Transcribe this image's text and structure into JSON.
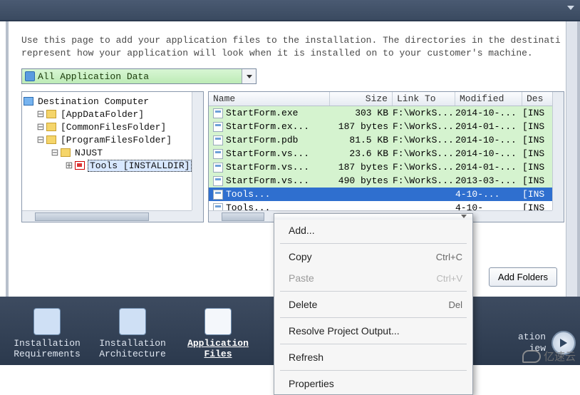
{
  "help_line1": "Use this page to add your application files to the installation. The directories in the destinati",
  "help_line2": "represent how your application will look when it is installed on to your customer's machine.",
  "filter_label": "All Application Data",
  "tree": {
    "root": "Destination Computer",
    "n1": "[AppDataFolder]",
    "n2": "[CommonFilesFolder]",
    "n3": "[ProgramFilesFolder]",
    "n3a": "NJUST",
    "n3a1": "Tools [INSTALLDIR]"
  },
  "cols": {
    "name": "Name",
    "size": "Size",
    "link": "Link To",
    "mod": "Modified",
    "dest": "Des"
  },
  "rows": [
    {
      "name": "StartForm.exe",
      "size": "303 KB",
      "link": "F:\\WorkS...",
      "mod": "2014-10-...",
      "dest": "[INS"
    },
    {
      "name": "StartForm.ex...",
      "size": "187 bytes",
      "link": "F:\\WorkS...",
      "mod": "2014-01-...",
      "dest": "[INS"
    },
    {
      "name": "StartForm.pdb",
      "size": "81.5 KB",
      "link": "F:\\WorkS...",
      "mod": "2014-10-...",
      "dest": "[INS"
    },
    {
      "name": "StartForm.vs...",
      "size": "23.6 KB",
      "link": "F:\\WorkS...",
      "mod": "2014-10-...",
      "dest": "[INS"
    },
    {
      "name": "StartForm.vs...",
      "size": "187 bytes",
      "link": "F:\\WorkS...",
      "mod": "2014-01-...",
      "dest": "[INS"
    },
    {
      "name": "StartForm.vs...",
      "size": "490 bytes",
      "link": "F:\\WorkS...",
      "mod": "2013-03-...",
      "dest": "[INS"
    }
  ],
  "row_sel": {
    "name": "Tools...",
    "size": "",
    "link": "",
    "mod": "4-10-...",
    "dest": "[INS"
  },
  "row_last": {
    "name": "Tools...",
    "size": "",
    "link": "",
    "mod": "4-10-",
    "dest": "[INS"
  },
  "add_folders_btn": "Add Folders",
  "ctx": {
    "add": "Add...",
    "copy": "Copy",
    "copy_sc": "Ctrl+C",
    "paste": "Paste",
    "paste_sc": "Ctrl+V",
    "delete": "Delete",
    "delete_sc": "Del",
    "resolve": "Resolve Project Output...",
    "refresh": "Refresh",
    "props": "Properties"
  },
  "nav": {
    "a": "Installation",
    "a2": "Requirements",
    "b": "Installation",
    "b2": "Architecture",
    "c": "Application",
    "c2": "Files",
    "r": "ation",
    "r2": "iew"
  },
  "watermark": "亿速云"
}
